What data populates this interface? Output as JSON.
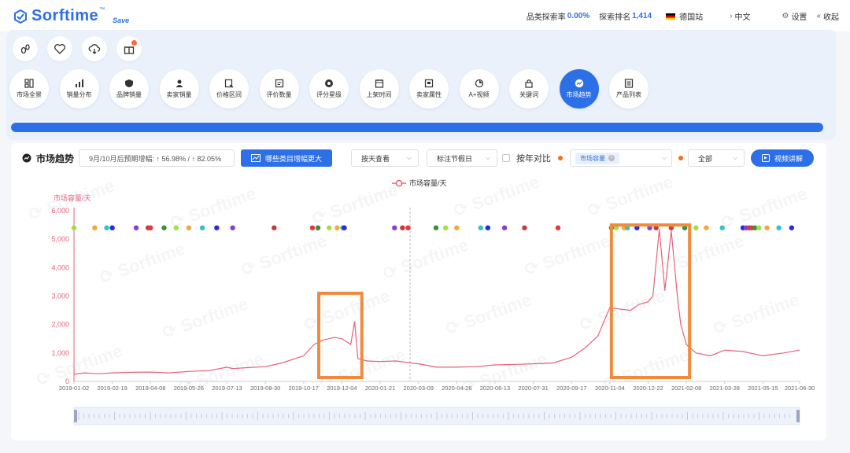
{
  "header": {
    "logo_text": "Sorftime",
    "logo_tm": "™",
    "logo_save": "Save",
    "search_rate_label": "品类探索率",
    "search_rate_value": "0.00%",
    "search_rank_label": "探索排名",
    "search_rank_value": "1,414",
    "site_label": "德国站",
    "lang_label": "中文",
    "settings_label": "设置",
    "collapse_label": "收起"
  },
  "toolbar": {
    "tools": [
      {
        "label": "市场全景",
        "icon": "grid-icon"
      },
      {
        "label": "销量分布",
        "icon": "bar-chart-icon"
      },
      {
        "label": "品牌销量",
        "icon": "shield-icon"
      },
      {
        "label": "卖家销量",
        "icon": "user-icon"
      },
      {
        "label": "价格区间",
        "icon": "price-tag-icon"
      },
      {
        "label": "评价数量",
        "icon": "review-icon"
      },
      {
        "label": "评分星级",
        "icon": "star-icon"
      },
      {
        "label": "上架时间",
        "icon": "calendar-icon"
      },
      {
        "label": "卖家属性",
        "icon": "seller-icon"
      },
      {
        "label": "A+视频",
        "icon": "video-icon"
      },
      {
        "label": "关键词",
        "icon": "lock-icon"
      },
      {
        "label": "市场趋势",
        "icon": "trend-icon"
      },
      {
        "label": "产品列表",
        "icon": "list-icon"
      }
    ],
    "active_index": 11,
    "progress_fraction": 1.0
  },
  "controls": {
    "title": "市场趋势",
    "prediction_text": "9月/10月后预期增幅: ↑ 56.98% / ↑ 82.05%",
    "compare_button": "哪些类目增幅更大",
    "view_select": "按天查看",
    "holiday_select": "标注节假日",
    "yoy_label": "按年对比",
    "metric_tag": "市场容量",
    "scope_select": "全部",
    "video_button": "视频讲解"
  },
  "colors": {
    "accent": "#2d6fe6",
    "line": "#e6617a",
    "highlight_box": "#f08a3c"
  },
  "chart_data": {
    "type": "line",
    "legend": "市场容量/天",
    "ylabel": "市场容量/天",
    "ylim": [
      0,
      6000
    ],
    "yticks": [
      "0",
      "1,000",
      "2,000",
      "3,000",
      "4,000",
      "5,000",
      "6,000"
    ],
    "xticks": [
      "2019-01-02",
      "2019-02-19",
      "2019-04-08",
      "2019-05-26",
      "2019-07-13",
      "2019-08-30",
      "2019-10-17",
      "2019-12-04",
      "2020-01-21",
      "2020-03-09",
      "2020-04-26",
      "2020-06-13",
      "2020-07-31",
      "2020-09-17",
      "2020-11-04",
      "2020-12-22",
      "2021-02-08",
      "2021-03-28",
      "2021-05-15",
      "2021-06-30"
    ],
    "series": [
      {
        "name": "市场容量/天",
        "x": [
          "2019-01-02",
          "2019-01-15",
          "2019-02-01",
          "2019-02-19",
          "2019-03-15",
          "2019-04-08",
          "2019-05-01",
          "2019-05-26",
          "2019-06-20",
          "2019-07-13",
          "2019-07-20",
          "2019-08-05",
          "2019-08-30",
          "2019-09-20",
          "2019-10-17",
          "2019-10-30",
          "2019-11-10",
          "2019-11-25",
          "2019-12-04",
          "2019-12-15",
          "2019-12-20",
          "2019-12-24",
          "2020-01-05",
          "2020-01-21",
          "2020-02-10",
          "2020-03-09",
          "2020-04-01",
          "2020-04-26",
          "2020-05-20",
          "2020-06-13",
          "2020-07-10",
          "2020-07-31",
          "2020-08-25",
          "2020-09-17",
          "2020-10-05",
          "2020-10-20",
          "2020-11-04",
          "2020-11-15",
          "2020-11-30",
          "2020-12-10",
          "2020-12-22",
          "2020-12-28",
          "2021-01-05",
          "2021-01-12",
          "2021-01-20",
          "2021-01-28",
          "2021-02-01",
          "2021-02-08",
          "2021-02-20",
          "2021-03-10",
          "2021-03-28",
          "2021-04-20",
          "2021-05-15",
          "2021-06-10",
          "2021-06-30"
        ],
        "y": [
          250,
          300,
          270,
          300,
          320,
          330,
          300,
          350,
          380,
          500,
          450,
          480,
          520,
          650,
          900,
          1300,
          1450,
          1550,
          1500,
          1300,
          2100,
          800,
          720,
          700,
          720,
          620,
          500,
          500,
          520,
          580,
          600,
          620,
          650,
          850,
          1200,
          1600,
          2600,
          2550,
          2500,
          2700,
          2800,
          3000,
          5350,
          3200,
          5300,
          2900,
          2000,
          1300,
          1000,
          900,
          1100,
          1050,
          900,
          1000,
          1100
        ]
      }
    ],
    "event_markers_at_y": 5400,
    "highlight_ranges": [
      [
        "2019-11-05",
        "2019-12-29"
      ],
      [
        "2020-11-06",
        "2021-02-12"
      ]
    ]
  }
}
